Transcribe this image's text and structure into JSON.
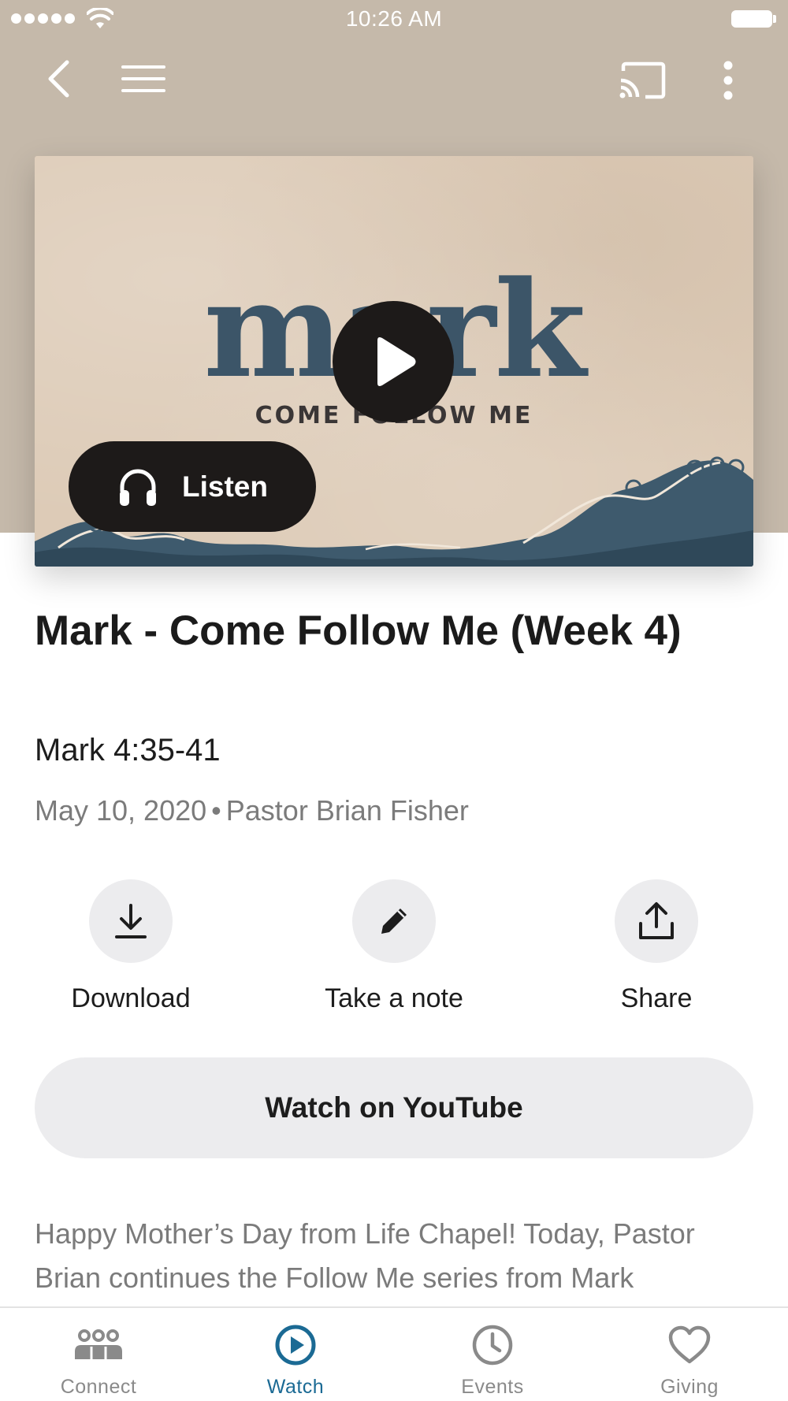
{
  "status_bar": {
    "time": "10:26 AM"
  },
  "header": {
    "back_icon": "chevron-left-icon",
    "menu_icon": "hamburger-menu-icon",
    "cast_icon": "cast-icon",
    "more_icon": "more-vertical-icon"
  },
  "artwork": {
    "word": "mark",
    "subtitle": "COME FOLLOW ME",
    "play_icon": "play-icon",
    "listen_label": "Listen",
    "listen_icon": "headphones-icon"
  },
  "sermon": {
    "title": "Mark - Come Follow Me (Week 4)",
    "passage": "Mark 4:35-41",
    "date": "May 10, 2020",
    "separator": "•",
    "speaker": "Pastor Brian Fisher"
  },
  "actions": {
    "download_label": "Download",
    "note_label": "Take a note",
    "share_label": "Share"
  },
  "youtube": {
    "label": "Watch on YouTube"
  },
  "description": "Happy Mother’s Day from Life Chapel! Today, Pastor Brian continues the Follow Me series from Mark",
  "tabbar": {
    "active": "Watch",
    "accent_color": "#1b6a94",
    "inactive_color": "#8a8a8a",
    "tabs": [
      {
        "label": "Connect",
        "icon": "people-icon"
      },
      {
        "label": "Watch",
        "icon": "play-circle-icon"
      },
      {
        "label": "Events",
        "icon": "clock-icon"
      },
      {
        "label": "Giving",
        "icon": "heart-icon"
      }
    ]
  },
  "colors": {
    "header_background": "#c5b9aa",
    "artwork_background": "#ddcbb7",
    "artwork_ink": "#3c5568",
    "button_dark": "#1d1a19",
    "button_light": "#ececee"
  }
}
